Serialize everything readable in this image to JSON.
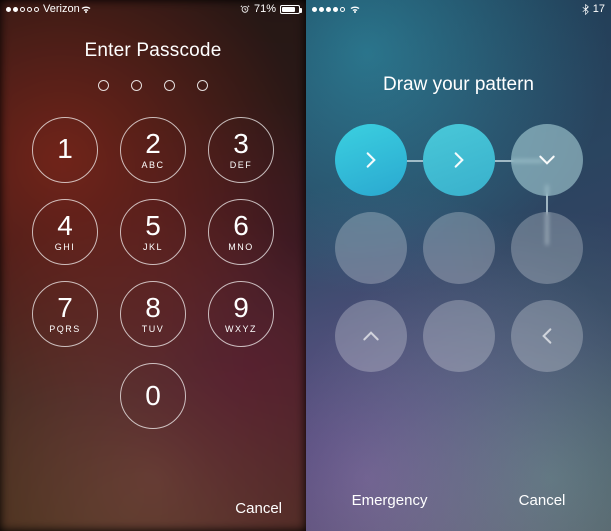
{
  "left": {
    "status": {
      "carrier": "Verizon",
      "signal_filled": 2,
      "battery_percent": "71%"
    },
    "prompt": "Enter Passcode",
    "passcode_length": 4,
    "keys": [
      {
        "num": "1",
        "letters": ""
      },
      {
        "num": "2",
        "letters": "ABC"
      },
      {
        "num": "3",
        "letters": "DEF"
      },
      {
        "num": "4",
        "letters": "GHI"
      },
      {
        "num": "5",
        "letters": "JKL"
      },
      {
        "num": "6",
        "letters": "MNO"
      },
      {
        "num": "7",
        "letters": "PQRS"
      },
      {
        "num": "8",
        "letters": "TUV"
      },
      {
        "num": "9",
        "letters": "WXYZ"
      },
      {
        "num": "0",
        "letters": ""
      }
    ],
    "cancel": "Cancel"
  },
  "right": {
    "status": {
      "signal_filled": 4,
      "right_text": "17"
    },
    "prompt": "Draw your pattern",
    "nodes": [
      {
        "arrow": "right",
        "active": true
      },
      {
        "arrow": "right",
        "active": true
      },
      {
        "arrow": "down",
        "active": true
      },
      {
        "arrow": "none",
        "active": false
      },
      {
        "arrow": "none",
        "active": false
      },
      {
        "arrow": "none",
        "active": false
      },
      {
        "arrow": "up",
        "active": false
      },
      {
        "arrow": "none",
        "active": false
      },
      {
        "arrow": "left",
        "active": false
      }
    ],
    "emergency": "Emergency",
    "cancel": "Cancel"
  }
}
